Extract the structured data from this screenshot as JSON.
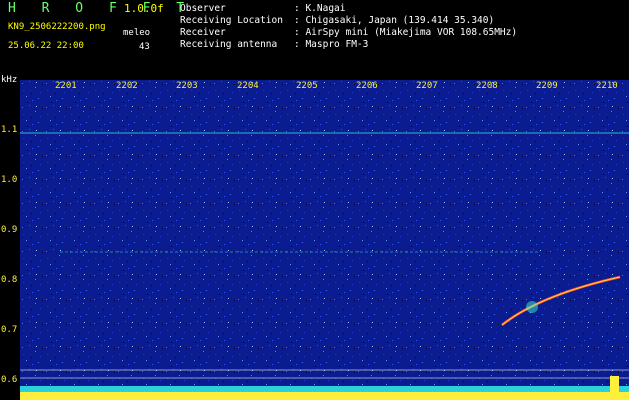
{
  "header": {
    "logo": "H R O F F T",
    "version": "1.0.0f",
    "filename": "KN9_2506222200.png",
    "datetime": "25.06.22 22:00",
    "meleo_label": "meleo",
    "count": "43"
  },
  "info": {
    "rows": [
      {
        "k": "Observer",
        "v": "K.Nagai"
      },
      {
        "k": "Receiving Location",
        "v": "Chigasaki, Japan (139.414 35.340)"
      },
      {
        "k": "Receiver",
        "v": "AirSpy mini (Miakejima VOR 108.65MHz)"
      },
      {
        "k": "Receiving antenna",
        "v": "Maspro FM-3"
      }
    ]
  },
  "axis": {
    "y_unit": "kHz",
    "y_labels": [
      "1.1",
      "1.0",
      "0.9",
      "0.8",
      "0.7",
      "0.6"
    ],
    "x_labels": [
      "2201",
      "2202",
      "2203",
      "2204",
      "2205",
      "2206",
      "2207",
      "2208",
      "2209",
      "2210"
    ]
  },
  "colors": {
    "background": "#000000",
    "plot_noise": "#0a1a8a",
    "label_yellow": "#ffef3a",
    "logo_green": "#66ff66",
    "carrier": "#2ee6e6"
  }
}
